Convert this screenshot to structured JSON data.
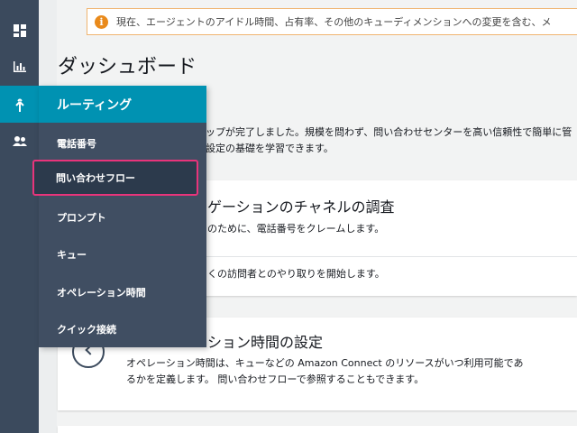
{
  "notice": {
    "icon": "info-icon",
    "text": "現在、エージェントのアイドル時間、占有率、その他のキューディメンションへの変更を含む、メ"
  },
  "page": {
    "title": "ダッシュボード"
  },
  "intro": {
    "line1": "ップが完了しました。規模を問わず、問い合わせセンターを高い信頼性で簡単に管",
    "line2": "設定の基礎を学習できます。"
  },
  "sections": {
    "channel": {
      "heading": "ゲーションのチャネルの調査",
      "phone_text": "のために、電話番号をクレームします。",
      "chat_text": "くの訪問者とのやり取りを開始します。"
    },
    "hours": {
      "heading": "ション時間の設定",
      "desc_line1": "オペレーション時間は、キューなどの Amazon Connect のリソースがいつ利用可能であ",
      "desc_line2": "るかを定義します。 問い合わせフローで参照することもできます。"
    }
  },
  "routing_menu": {
    "header": "ルーティング",
    "items": [
      "電話番号",
      "問い合わせフロー",
      "プロンプト",
      "キュー",
      "オペレーション時間",
      "クイック接続"
    ]
  },
  "colors": {
    "rail": "#3b4a5d",
    "accent": "#0092b2",
    "highlight_border": "#e8347b",
    "notice_border": "#f0b470",
    "notice_icon": "#e98a1b"
  }
}
